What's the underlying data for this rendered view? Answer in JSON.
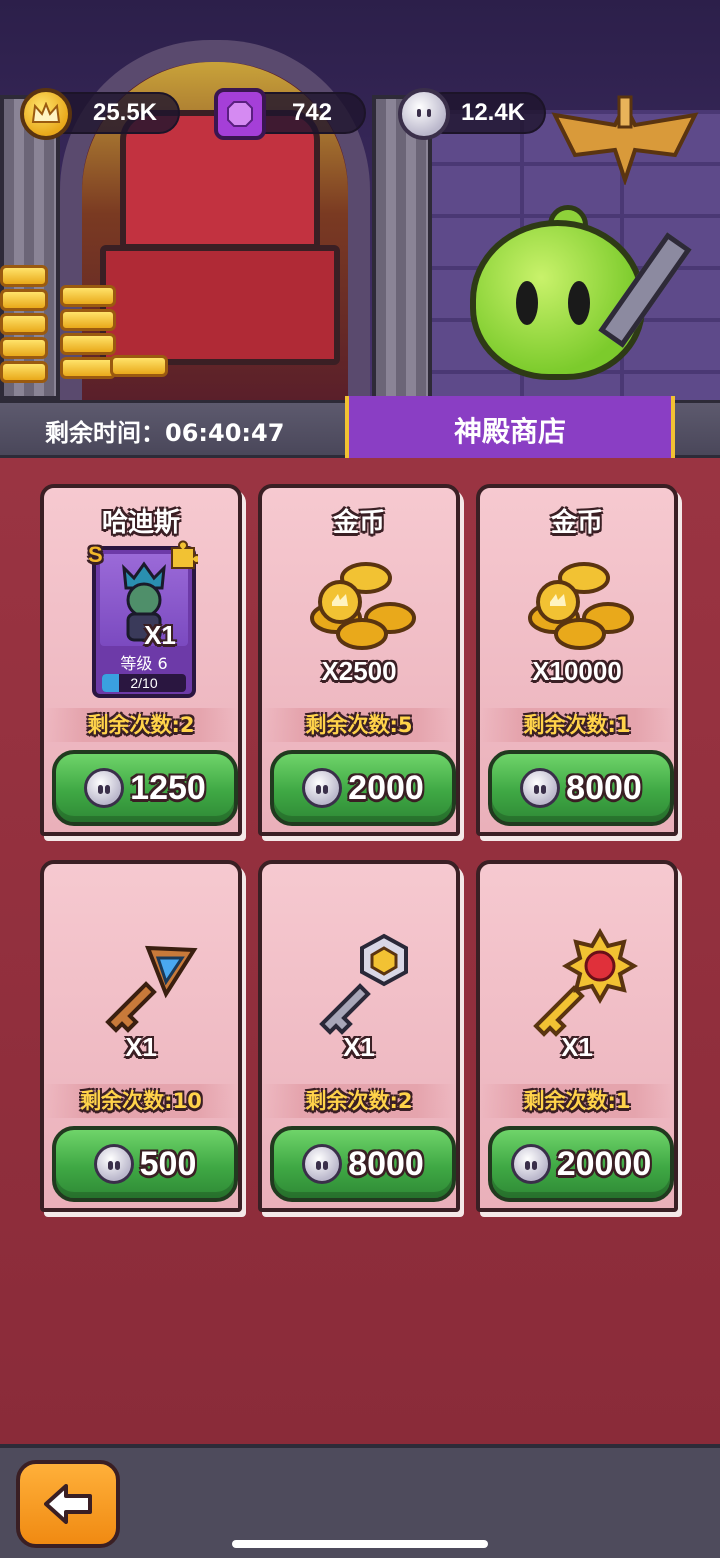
{
  "resources": {
    "gold": {
      "value": "25.5K",
      "icon": "crown-coin-icon"
    },
    "gems": {
      "value": "742",
      "icon": "purple-gem-icon"
    },
    "souls": {
      "value": "12.4K",
      "icon": "soul-icon"
    }
  },
  "timer": {
    "label": "剩余时间：",
    "value": "06:40:47"
  },
  "shop_title": "神殿商店",
  "items": [
    {
      "name": "哈迪斯",
      "kind": "hero-card",
      "rank": "S",
      "qty": "X1",
      "level": "等级 6",
      "progress_text": "2/10",
      "progress": 0.2,
      "limit": "剩余次数:2",
      "price": "1250"
    },
    {
      "name": "金币",
      "kind": "gold-coins",
      "qty": "X2500",
      "limit": "剩余次数:5",
      "price": "2000"
    },
    {
      "name": "金币",
      "kind": "gold-coins",
      "qty": "X10000",
      "limit": "剩余次数:1",
      "price": "8000"
    },
    {
      "name": "",
      "kind": "bronze-key",
      "qty": "X1",
      "limit": "剩余次数:10",
      "price": "500"
    },
    {
      "name": "",
      "kind": "silver-key",
      "qty": "X1",
      "limit": "剩余次数:2",
      "price": "8000"
    },
    {
      "name": "",
      "kind": "gold-key",
      "qty": "X1",
      "limit": "剩余次数:1",
      "price": "20000"
    }
  ],
  "colors": {
    "background": "#8e2f3c",
    "card": "#f6c9d0",
    "button_green": "#3fa844",
    "banner_purple": "#8a3ec4",
    "limit_text": "#ffd34a"
  }
}
